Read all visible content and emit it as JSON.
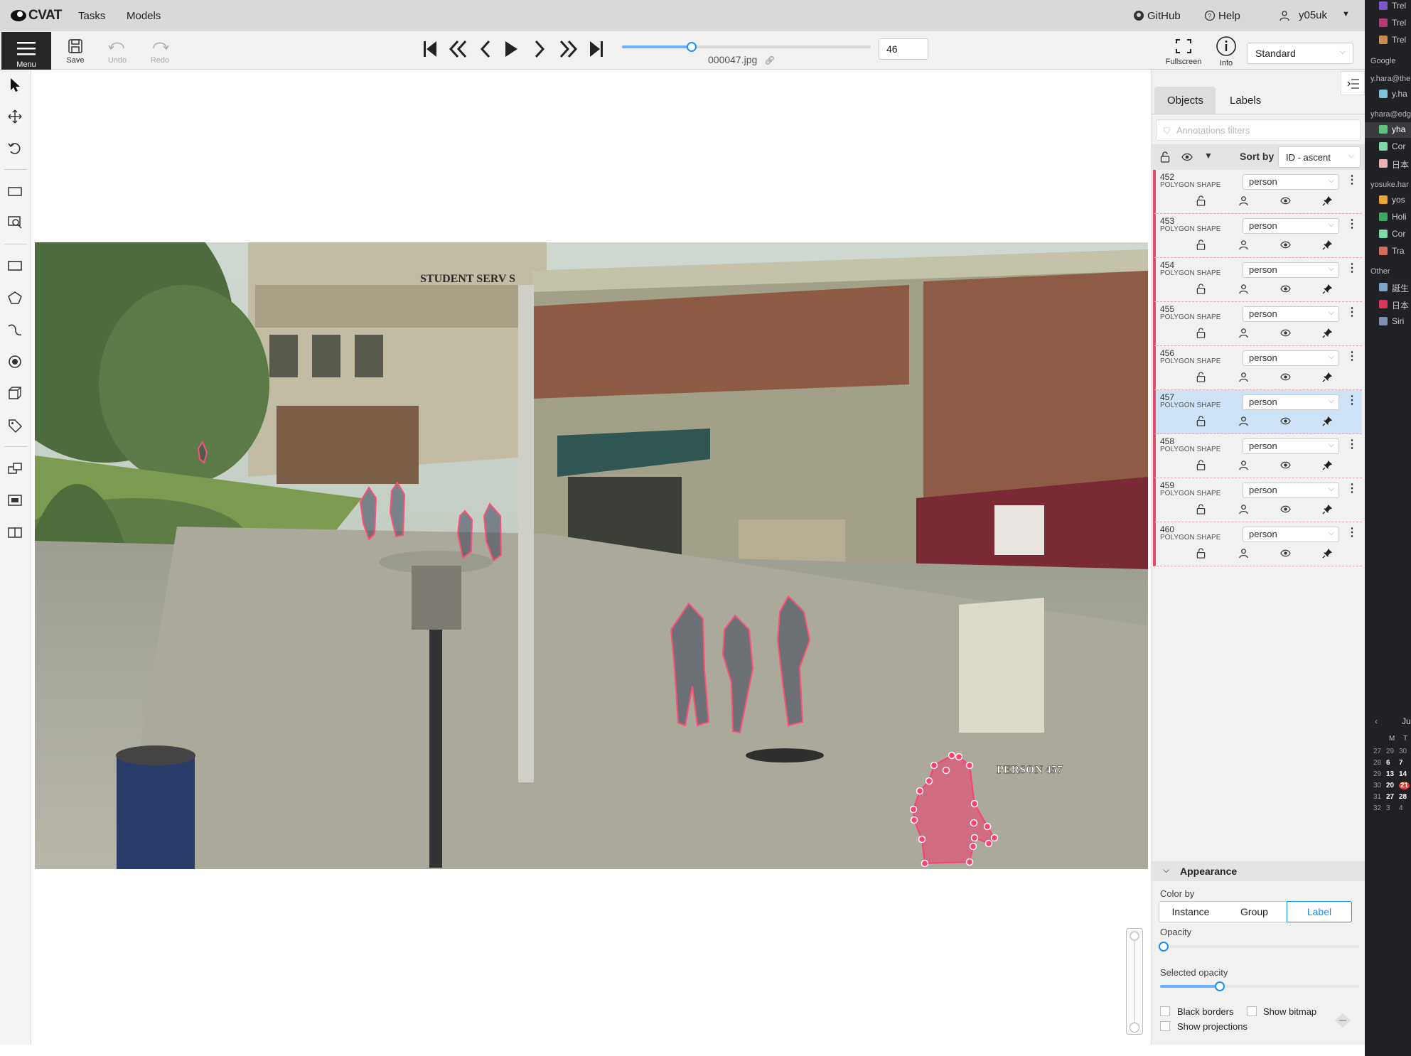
{
  "nav": {
    "logo": "CVAT",
    "tasks": "Tasks",
    "models": "Models",
    "github": "GitHub",
    "help": "Help",
    "user": "y05uk"
  },
  "toolbar": {
    "menu": "Menu",
    "save": "Save",
    "undo": "Undo",
    "redo": "Redo",
    "filename": "000047.jpg",
    "frame_number": "46",
    "frame_progress": 0.28,
    "fullscreen": "Fullscreen",
    "info": "Info",
    "workspace": "Standard"
  },
  "canvas": {
    "sign_text": "STUDENT SERV    S",
    "selected_label": "PERSON 457"
  },
  "panel": {
    "tabs": [
      "Objects",
      "Labels"
    ],
    "filter_placeholder": "Annotations filters",
    "sort_label": "Sort by",
    "sort_value": "ID - ascent",
    "objects": [
      {
        "id": "452",
        "type": "POLYGON SHAPE",
        "label": "person",
        "selected": false
      },
      {
        "id": "453",
        "type": "POLYGON SHAPE",
        "label": "person",
        "selected": false
      },
      {
        "id": "454",
        "type": "POLYGON SHAPE",
        "label": "person",
        "selected": false
      },
      {
        "id": "455",
        "type": "POLYGON SHAPE",
        "label": "person",
        "selected": false
      },
      {
        "id": "456",
        "type": "POLYGON SHAPE",
        "label": "person",
        "selected": false
      },
      {
        "id": "457",
        "type": "POLYGON SHAPE",
        "label": "person",
        "selected": true
      },
      {
        "id": "458",
        "type": "POLYGON SHAPE",
        "label": "person",
        "selected": false
      },
      {
        "id": "459",
        "type": "POLYGON SHAPE",
        "label": "person",
        "selected": false
      },
      {
        "id": "460",
        "type": "POLYGON SHAPE",
        "label": "person",
        "selected": false
      }
    ],
    "appearance": {
      "title": "Appearance",
      "color_by": "Color by",
      "options": [
        "Instance",
        "Group",
        "Label"
      ],
      "active_option": "Label",
      "opacity": "Opacity",
      "opacity_value": 0.0,
      "selected_opacity": "Selected opacity",
      "selected_opacity_value": 0.3,
      "black_borders": "Black borders",
      "show_bitmap": "Show bitmap",
      "show_projections": "Show projections"
    }
  },
  "strip": {
    "items_top": [
      "Trel",
      "Trel",
      "Trel"
    ],
    "google": "Google",
    "acc1": "y.hara@the",
    "acc1_items": [
      "y.ha"
    ],
    "acc2": "yhara@edg",
    "acc2_items": [
      "yha",
      "Cor",
      "日本"
    ],
    "acc3": "yosuke.har",
    "acc3_items": [
      "yos",
      "Holi",
      "Cor",
      "Tra"
    ],
    "other": "Other",
    "other_items": [
      "誕生",
      "日本",
      "Siri"
    ],
    "cal_header": "Ju",
    "cal_days": [
      "M",
      "T"
    ],
    "cal_rows": [
      [
        "27",
        "29",
        "30"
      ],
      [
        "28",
        "6",
        "7"
      ],
      [
        "29",
        "13",
        "14"
      ],
      [
        "30",
        "20",
        "21"
      ],
      [
        "31",
        "27",
        "28"
      ],
      [
        "32",
        "3",
        "4"
      ]
    ]
  },
  "colors": {
    "accent": "#1890ff",
    "polygon": "#e8456c",
    "selected_row": "#cfe3f6"
  }
}
